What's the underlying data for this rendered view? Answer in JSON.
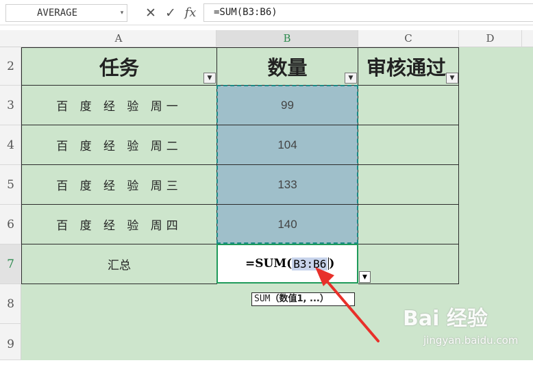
{
  "formula_bar": {
    "name_box": "AVERAGE",
    "cancel_icon": "✕",
    "enter_icon": "✓",
    "fx_label": "fx",
    "formula": "=SUM(B3:B6)"
  },
  "columns": [
    "A",
    "B",
    "C",
    "D"
  ],
  "rows": [
    "2",
    "3",
    "4",
    "5",
    "6",
    "7",
    "8",
    "9"
  ],
  "headers": {
    "task": "任务",
    "quantity": "数量",
    "approved": "审核通过"
  },
  "data_rows": [
    {
      "task": "百 度 经 验  周一",
      "qty": "99"
    },
    {
      "task": "百 度 经 验  周二",
      "qty": "104"
    },
    {
      "task": "百 度 经 验  周三",
      "qty": "133"
    },
    {
      "task": "百 度 经 验  周四",
      "qty": "140"
    }
  ],
  "summary": {
    "label": "汇总",
    "edit_prefix": "=SUM(",
    "edit_ref": "B3:B6",
    "edit_suffix": ")"
  },
  "tooltip": {
    "func": "SUM",
    "args_open": "（",
    "args": "数值1, ...",
    "args_close": "）"
  },
  "watermark": {
    "logo": "Bai 经验",
    "url": "jingyan.baidu.com"
  },
  "colors": {
    "grid_bg": "#cde5cc",
    "selection": "#9fbfca",
    "accent": "#1e9a5a",
    "arrow": "#e8302a"
  }
}
